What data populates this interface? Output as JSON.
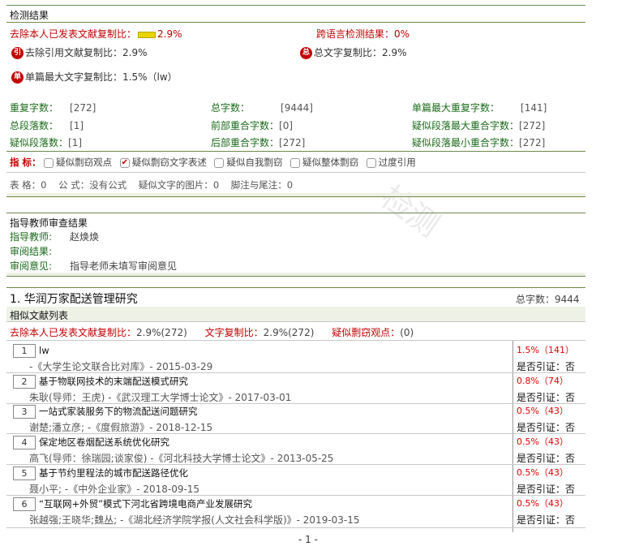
{
  "detection": {
    "section_title": "检测结果",
    "self_excl_label": "去除本人已发表文献复制比：",
    "self_excl_value": "2.9%",
    "cross_lang_label": "跨语言检测结果：",
    "cross_lang_value": "0%",
    "cite_excl_label": "去除引用文献复制比：",
    "cite_excl_value": "2.9%",
    "total_copy_label": "总文字复制比：",
    "total_copy_value": "2.9%",
    "single_max_label": "单篇最大文字复制比：",
    "single_max_value": "1.5%（lw）",
    "icon_cite_glyph": "引",
    "icon_total_glyph": "总",
    "icon_single_glyph": "单",
    "stats": [
      {
        "label": "重复字数：",
        "value": "[272]"
      },
      {
        "label": "总字数：",
        "value": "[9444]"
      },
      {
        "label": "单篇最大重复字数：",
        "value": "[141]"
      },
      {
        "label": "总段落数：",
        "value": "[1]"
      },
      {
        "label": "前部重合字数：",
        "value": "[0]"
      },
      {
        "label": "疑似段落最大重合字数：",
        "value": "[272]"
      },
      {
        "label": "疑似段落数：",
        "value": "[1]"
      },
      {
        "label": "后部重合字数：",
        "value": "[272]"
      },
      {
        "label": "疑似段落最小重合字数：",
        "value": "[272]"
      }
    ],
    "indicators_label": "指  标：",
    "indicators": [
      {
        "label": "疑似剽窃观点",
        "checked": false
      },
      {
        "label": "疑似剽窃文字表述",
        "checked": true
      },
      {
        "label": "疑似自我剽窃",
        "checked": false
      },
      {
        "label": "疑似整体剽窃",
        "checked": false
      },
      {
        "label": "过度引用",
        "checked": false
      }
    ],
    "misc_line": "表 格：0    公 式：没有公式    疑似文字的图片：0    脚注与尾注：0"
  },
  "review": {
    "section_title": "指导教师审查结果",
    "teacher_label": "指导教师:",
    "teacher_value": "赵焕焕",
    "result_label": "审阅结果:",
    "opinion_label": "审阅意见:",
    "opinion_value": "指导老师未填写审阅意见"
  },
  "paper": {
    "title": "1. 华润万家配送管理研究",
    "total_words": "总字数：9444",
    "similar_list_label": "相似文献列表",
    "summary_self_label": "去除本人已发表文献复制比：",
    "summary_self_value": "2.9%(272)",
    "summary_text_label": "文字复制比：",
    "summary_text_value": "2.9%(272)",
    "summary_view_label": "疑似剽窃观点：",
    "summary_view_value": "(0)",
    "cite_label": "是否引证：否",
    "refs": [
      {
        "num": "1",
        "title": "lw",
        "meta": "-《大学生论文联合比对库》- 2015-03-29",
        "stat": "1.5%（141）"
      },
      {
        "num": "2",
        "title": "基于物联网技术的末端配送模式研究",
        "meta": "朱耿(导师：王虎) -《武汉理工大学博士论文》- 2017-03-01",
        "stat": "0.8%（74）"
      },
      {
        "num": "3",
        "title": "一站式家装服务下的物流配送问题研究",
        "meta": "谢楚;潘立彦; -《度假旅游》- 2018-12-15",
        "stat": "0.5%（43）"
      },
      {
        "num": "4",
        "title": "保定地区卷烟配送系统优化研究",
        "meta": "高飞(导师：徐瑞园;谈家俊) -《河北科技大学博士论文》- 2013-05-25",
        "stat": "0.5%（43）"
      },
      {
        "num": "5",
        "title": "基于节约里程法的城市配送路径优化",
        "meta": "聂小平; -《中外企业家》- 2018-09-15",
        "stat": "0.5%（43）"
      },
      {
        "num": "6",
        "title": "“互联网+外贸”模式下河北省跨境电商产业发展研究",
        "meta": "张越强;王晓华;魏丛; -《湖北经济学院学报(人文社会科学版)》- 2019-03-15",
        "stat": "0.5%（43）"
      }
    ]
  },
  "page_number": "- 1 -"
}
